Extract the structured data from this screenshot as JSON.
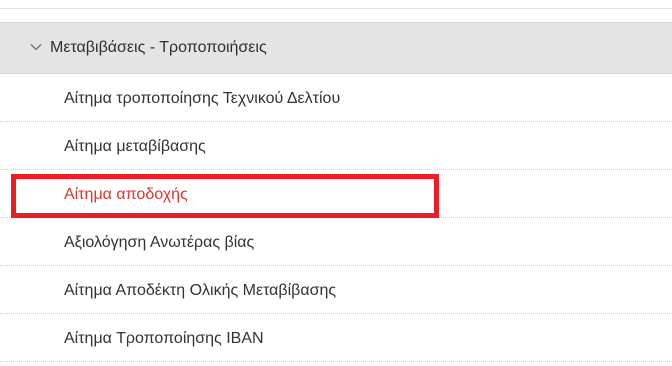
{
  "section": {
    "title": "Μεταβιβάσεις - Τροποποιήσεις",
    "expanded_icon": "chevron-down-icon"
  },
  "menu": {
    "items": [
      {
        "label": "Αίτημα τροποποίησης Τεχνικού Δελτίου",
        "active": false
      },
      {
        "label": "Αίτημα μεταβίβασης",
        "active": false
      },
      {
        "label": "Αίτημα αποδοχής",
        "active": true
      },
      {
        "label": "Αξιολόγηση Ανωτέρας βίας",
        "active": false
      },
      {
        "label": "Αίτημα Αποδέκτη Ολικής Μεταβίβασης",
        "active": false
      },
      {
        "label": "Αίτημα Τροποποίησης IBAN",
        "active": false
      }
    ]
  },
  "colors": {
    "active_text": "#e0352e",
    "highlight_border": "#ee1c25",
    "header_background": "#e4e4e4"
  }
}
